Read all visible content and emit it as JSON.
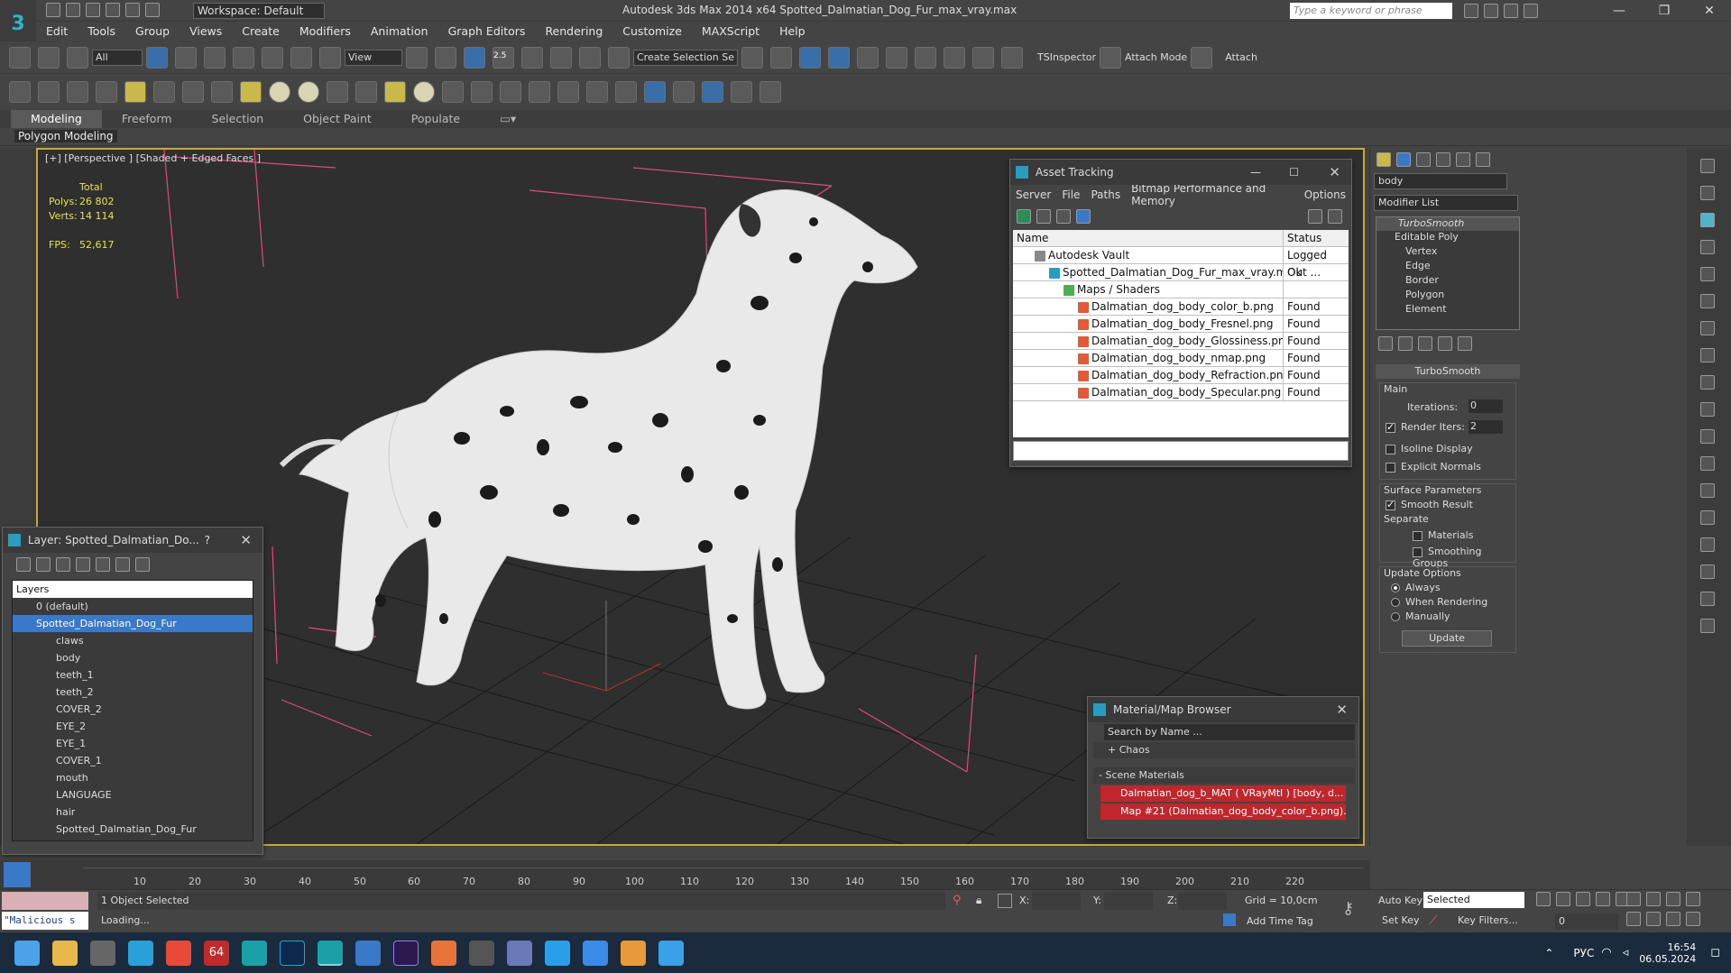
{
  "titlebar": {
    "workspace": "Workspace: Default",
    "app_title": "Autodesk 3ds Max  2014 x64     Spotted_Dalmatian_Dog_Fur_max_vray.max",
    "search_placeholder": "Type a keyword or phrase"
  },
  "menu": [
    "Edit",
    "Tools",
    "Group",
    "Views",
    "Create",
    "Modifiers",
    "Animation",
    "Graph Editors",
    "Rendering",
    "Customize",
    "MAXScript",
    "Help"
  ],
  "toolbar": {
    "filter_dropdown": "All",
    "refcoord_dropdown": "View",
    "snap_value": "2.5",
    "selection_set": "Create Selection Se",
    "ts_inspector": "TSInspector",
    "attach_mode": "Attach Mode",
    "attach": "Attach"
  },
  "ribbon": {
    "tabs": [
      "Modeling",
      "Freeform",
      "Selection",
      "Object Paint",
      "Populate"
    ],
    "active_tab": "Modeling",
    "subtitle": "Polygon Modeling"
  },
  "viewport": {
    "label": "[+] [Perspective ] [Shaded + Edged Faces ]",
    "stats": {
      "total_label": "Total",
      "polys_label": "Polys:",
      "polys_value": "26 802",
      "verts_label": "Verts:",
      "verts_value": "14 114",
      "fps_label": "FPS:",
      "fps_value": "52,617"
    }
  },
  "asset_tracking": {
    "title": "Asset Tracking",
    "menu": [
      "Server",
      "File",
      "Paths",
      "Bitmap Performance and Memory",
      "Options"
    ],
    "columns": [
      "Name",
      "Status"
    ],
    "rows": [
      {
        "name": "Autodesk Vault",
        "status": "Logged Out ..."
      },
      {
        "name": "Spotted_Dalmatian_Dog_Fur_max_vray.max",
        "status": "Ok"
      },
      {
        "name": "Maps / Shaders",
        "status": ""
      },
      {
        "name": "Dalmatian_dog_body_color_b.png",
        "status": "Found"
      },
      {
        "name": "Dalmatian_dog_body_Fresnel.png",
        "status": "Found"
      },
      {
        "name": "Dalmatian_dog_body_Glossiness.png",
        "status": "Found"
      },
      {
        "name": "Dalmatian_dog_body_nmap.png",
        "status": "Found"
      },
      {
        "name": "Dalmatian_dog_body_Refraction.png",
        "status": "Found"
      },
      {
        "name": "Dalmatian_dog_body_Specular.png",
        "status": "Found"
      }
    ]
  },
  "layer_panel": {
    "title": "Layer: Spotted_Dalmatian_Do...",
    "header": "Layers",
    "items": [
      "0 (default)",
      "Spotted_Dalmatian_Dog_Fur",
      "claws",
      "body",
      "teeth_1",
      "teeth_2",
      "COVER_2",
      "EYE_2",
      "EYE_1",
      "COVER_1",
      "mouth",
      "LANGUAGE",
      "hair",
      "Spotted_Dalmatian_Dog_Fur"
    ]
  },
  "material_browser": {
    "title": "Material/Map Browser",
    "search_placeholder": "Search by Name ...",
    "chaos": "+ Chaos",
    "scene_materials": "- Scene Materials",
    "items": [
      "Dalmatian_dog_b_MAT ( VRayMtl ) [body, d...",
      "Map #21 (Dalmatian_dog_body_color_b.png)..."
    ]
  },
  "command_panel": {
    "object_name": "body",
    "modifier_list": "Modifier List",
    "stack": [
      "TurboSmooth",
      "Editable Poly",
      "Vertex",
      "Edge",
      "Border",
      "Polygon",
      "Element"
    ],
    "rollout_title": "TurboSmooth",
    "main_label": "Main",
    "iterations_label": "Iterations:",
    "iterations_value": "0",
    "render_iters_label": "Render Iters:",
    "render_iters_value": "2",
    "isoline": "Isoline Display",
    "explicit_normals": "Explicit Normals",
    "surface_params": "Surface Parameters",
    "smooth_result": "Smooth Result",
    "separate": "Separate",
    "materials": "Materials",
    "smoothing_groups": "Smoothing Groups",
    "update_options": "Update Options",
    "always": "Always",
    "when_rendering": "When Rendering",
    "manually": "Manually",
    "update_button": "Update"
  },
  "timeline": {
    "ticks": [
      "10",
      "20",
      "30",
      "40",
      "50",
      "60",
      "70",
      "80",
      "90",
      "100",
      "110",
      "120",
      "130",
      "140",
      "150",
      "160",
      "170",
      "180",
      "190",
      "200",
      "210",
      "220"
    ]
  },
  "statusbar": {
    "script_text": "\"Malicious s",
    "selected": "1 Object Selected",
    "loading": "Loading...",
    "x_label": "X:",
    "y_label": "Y:",
    "z_label": "Z:",
    "grid": "Grid = 10,0cm",
    "add_time_tag": "Add Time Tag",
    "auto_key": "Auto Key",
    "set_key": "Set Key",
    "selected_dropdown": "Selected",
    "key_filters": "Key Filters...",
    "frame": "0"
  },
  "taskbar": {
    "lang": "РУС",
    "time": "16:54",
    "date": "06.05.2024",
    "badge": "64"
  }
}
